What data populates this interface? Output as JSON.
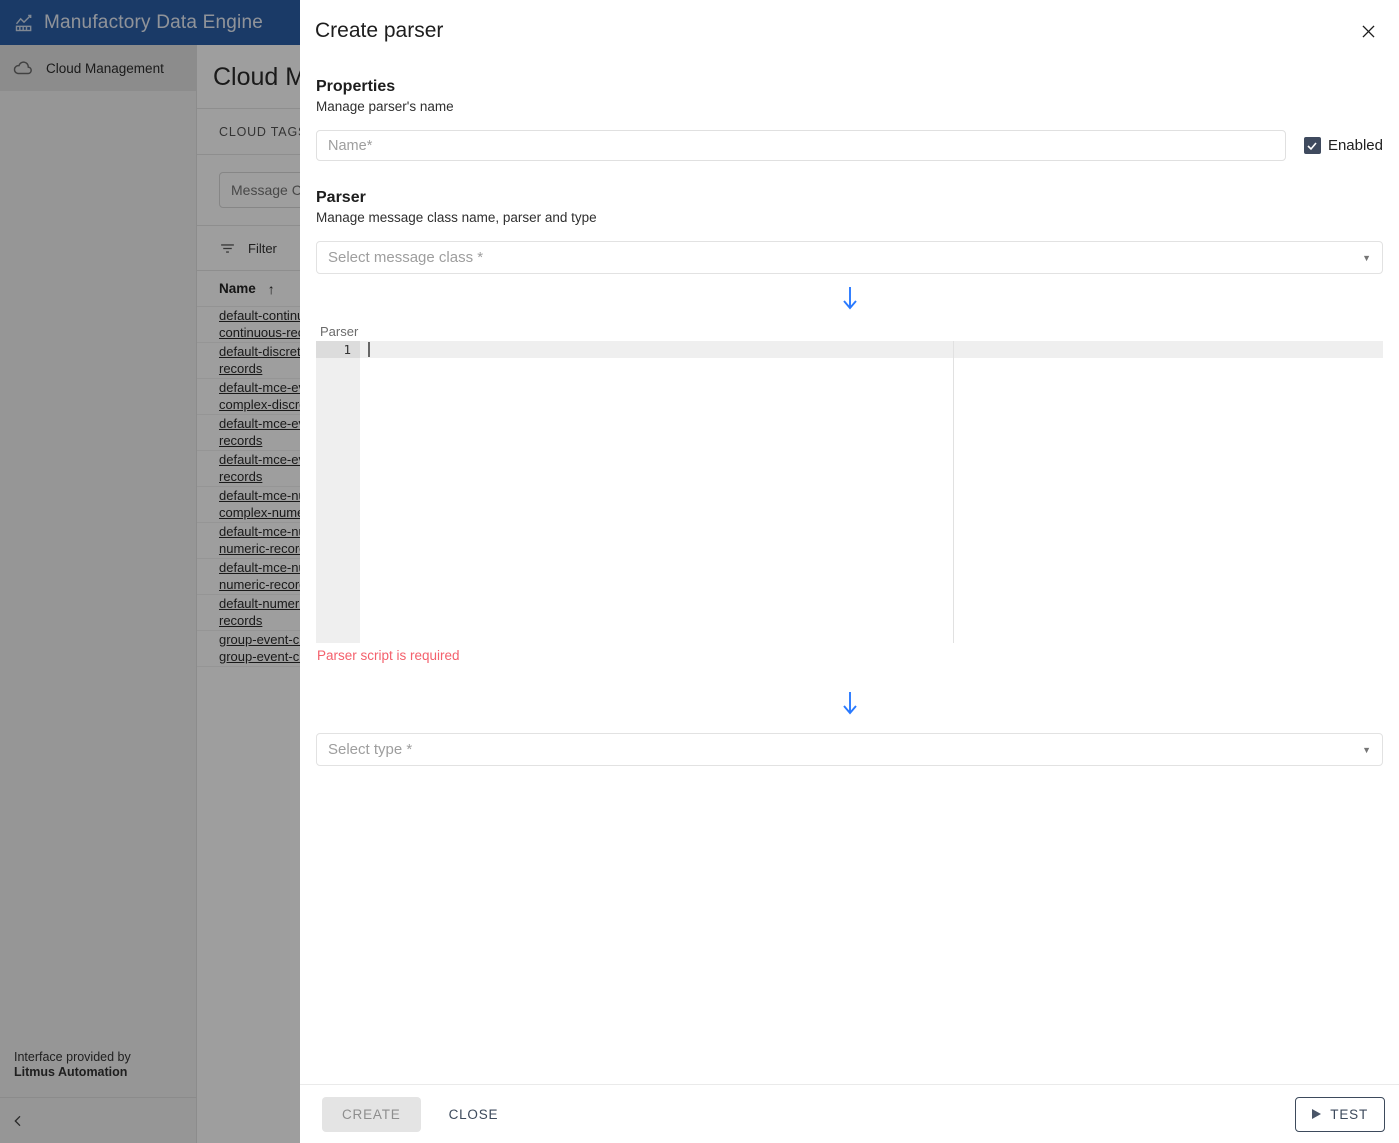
{
  "app": {
    "title": "Manufactory Data Engine",
    "logo_icon": "analytics-chart-icon",
    "brand_color": "#2b5ea7",
    "sidebar": {
      "items": [
        {
          "label": "Cloud Management",
          "icon": "cloud-icon"
        }
      ],
      "footer_line1": "Interface provided by",
      "footer_line2": "Litmus Automation",
      "collapse_icon": "chevron-left-icon"
    },
    "main": {
      "page_title": "Cloud Management",
      "tab_label": "CLOUD TAGS",
      "search_placeholder": "Message Class",
      "filter_label": "Filter",
      "filter_icon": "filter-icon",
      "table": {
        "column_header": "Name",
        "sort_icon": "arrow-up-icon",
        "rows": [
          [
            "default-continuous-records",
            "continuous-records"
          ],
          [
            "default-discrete-records",
            "records"
          ],
          [
            "default-mce-event-complex-discrete",
            "complex-discrete"
          ],
          [
            "default-mce-event-records",
            "records"
          ],
          [
            "default-mce-event-records",
            "records"
          ],
          [
            "default-mce-numeric-complex-numeric",
            "complex-numeric"
          ],
          [
            "default-mce-numeric-records",
            "numeric-records"
          ],
          [
            "default-mce-numeric-records",
            "numeric-records"
          ],
          [
            "default-numeric-records",
            "records"
          ],
          [
            "group-event-class",
            "group-event-class"
          ]
        ]
      }
    }
  },
  "dialog": {
    "title": "Create parser",
    "close_icon": "close-icon",
    "properties": {
      "heading": "Properties",
      "subheading": "Manage parser's name",
      "name_placeholder": "Name",
      "name_required_marker": "*",
      "name_value": "",
      "enabled_label": "Enabled",
      "enabled_checked": true,
      "checkbox_color": "#3f4a5e",
      "check_icon": "check-icon"
    },
    "parser": {
      "heading": "Parser",
      "subheading": "Manage message class name, parser and type",
      "message_class_placeholder": "Select message class",
      "message_class_required_marker": "*",
      "message_class_value": "",
      "dropdown_icon": "chevron-down-icon",
      "flow_arrow_icon": "arrow-down-icon",
      "flow_arrow_color": "#2979ff",
      "editor_label": "Parser",
      "editor_line_number": "1",
      "editor_content": "",
      "error_message": "Parser script is required",
      "error_color": "#f4606c",
      "type_placeholder": "Select type",
      "type_required_marker": "*",
      "type_value": ""
    },
    "footer": {
      "create_label": "CREATE",
      "create_disabled": true,
      "close_label": "CLOSE",
      "test_label": "TEST",
      "test_icon": "play-icon"
    }
  }
}
